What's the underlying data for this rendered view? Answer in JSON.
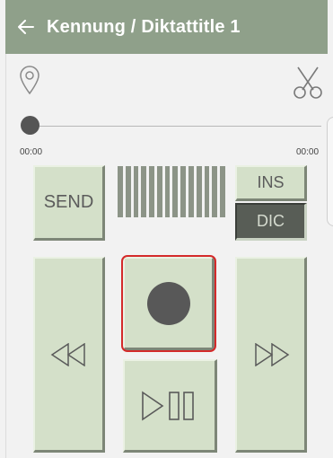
{
  "header": {
    "title": "Kennung / Diktattitle 1"
  },
  "icons": {
    "back": "back-arrow-icon",
    "location": "location-pin-icon",
    "cut": "scissors-icon",
    "record": "record-icon",
    "rewind": "rewind-icon",
    "forward": "fast-forward-icon",
    "play_pause": "play-pause-icon"
  },
  "player": {
    "position": "00:00",
    "duration": "00:00",
    "progress": 0
  },
  "controls": {
    "send_label": "SEND",
    "insert_label": "INS",
    "dictate_label": "DIC",
    "mode_selected": "DIC"
  },
  "level_meter": {
    "bars": 14
  },
  "colors": {
    "header": "#8fa08a",
    "button": "#d4e0c9",
    "active_mode": "#585d56",
    "highlight": "#d42a2a"
  }
}
